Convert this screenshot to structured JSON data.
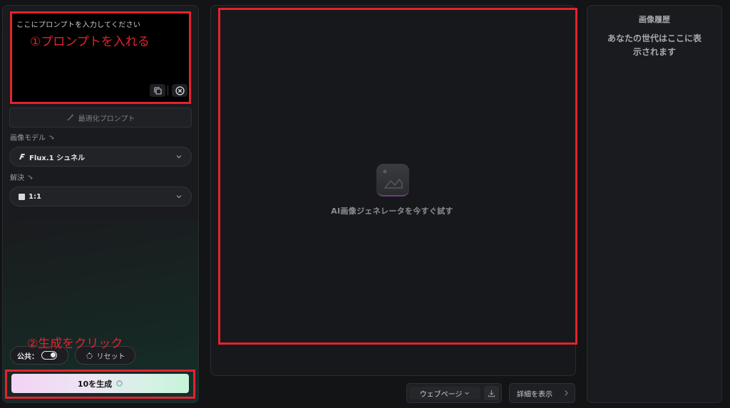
{
  "prompt": {
    "placeholder": "ここにプロンプトを入力してください",
    "copy_icon": "copy-icon",
    "clear_icon": "close-circle-icon"
  },
  "optimize": {
    "label": "最適化プロンプト",
    "icon": "magic-wand-icon"
  },
  "model": {
    "section_label": "画像モデル",
    "selected": "Flux.1 シュネル",
    "icon": "flux-logo-icon"
  },
  "resolution": {
    "section_label": "解決",
    "selected": "1:1",
    "icon": "square-icon"
  },
  "controls": {
    "public_label": "公共：",
    "public_on": true,
    "reset_label": "リセット"
  },
  "generate": {
    "label": "10を生成"
  },
  "annotations": {
    "step1": "①プロンプトを入れる",
    "step2": "②生成をクリック",
    "color": "#e3232f"
  },
  "canvas": {
    "empty_text": "AI画像ジェネレータを今すぐ試す",
    "icon": "image-placeholder-icon"
  },
  "footer": {
    "webpage_label": "ウェブページ",
    "download_icon": "download-icon",
    "details_label": "詳細を表示"
  },
  "history": {
    "title": "画像履歴",
    "empty_text": "あなたの世代はここに表示されます"
  },
  "colors": {
    "background": "#131416",
    "panel": "#1a1b1e",
    "generate_gradient_start": "#f3d3f4",
    "generate_gradient_end": "#c6f3d8"
  }
}
